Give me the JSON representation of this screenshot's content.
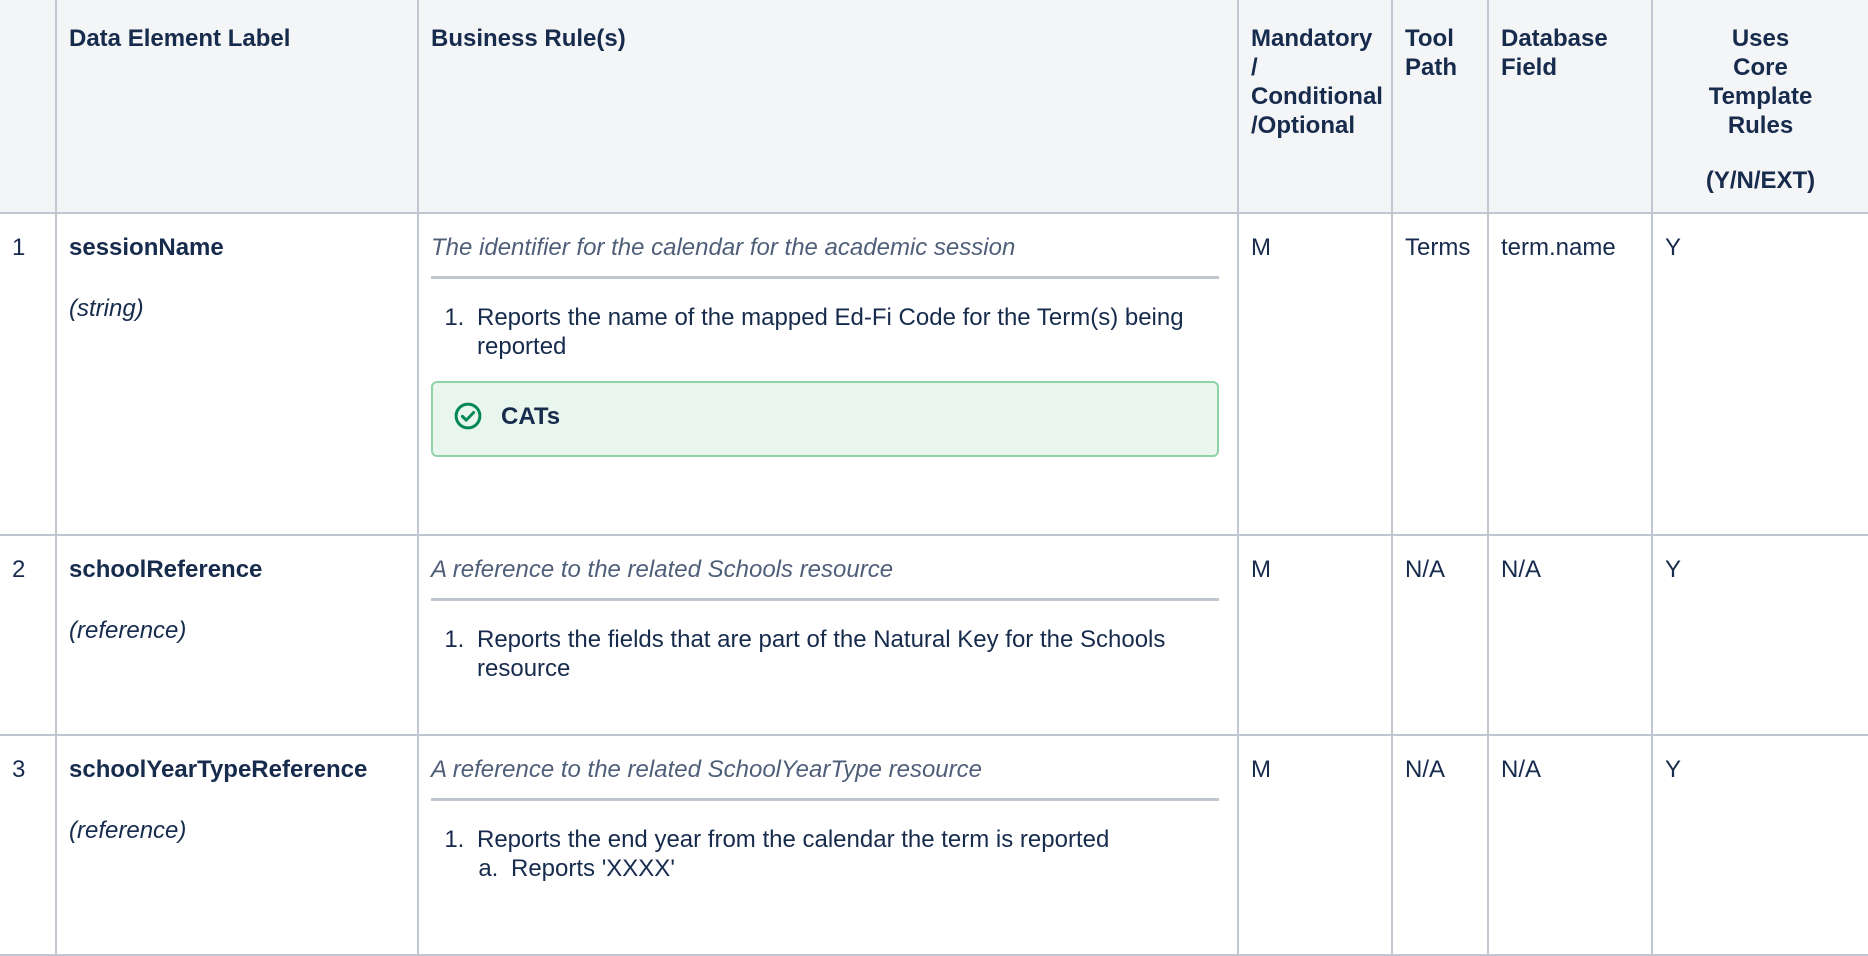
{
  "header": {
    "num": "",
    "label": "Data Element Label",
    "rules": "Business Rule(s)",
    "mandatory": [
      "Mandatory /",
      "Conditional",
      "/Optional"
    ],
    "tool_path": [
      "Tool",
      "Path"
    ],
    "db_field": [
      "Database",
      "Field"
    ],
    "core": [
      "Uses",
      "Core",
      "Template",
      "Rules"
    ],
    "core_sub": "(Y/N/EXT)"
  },
  "rows": [
    {
      "num": "1",
      "name": "sessionName",
      "type": "(string)",
      "description": "The identifier for the calendar for the academic session",
      "rule1": "Reports the name of the mapped Ed-Fi Code for the Term(s) being reported",
      "panel_title": "CATs",
      "mandatory": "M",
      "tool_path": "Terms",
      "db_field": "term.name",
      "core": "Y"
    },
    {
      "num": "2",
      "name": "schoolReference",
      "type": "(reference)",
      "description": "A reference to the related Schools resource",
      "rule1": " Reports the fields that are part of the Natural Key for the Schools resource",
      "mandatory": "M",
      "tool_path": "N/A",
      "db_field": "N/A",
      "core": "Y"
    },
    {
      "num": "3",
      "name": "schoolYearTypeReference",
      "type": "(reference)",
      "description": "A reference to the related SchoolYearType resource",
      "rule1": "Reports the end year from the calendar the term is reported",
      "rule1a": "Reports 'XXXX'",
      "mandatory": "M",
      "tool_path": "N/A",
      "db_field": "N/A",
      "core": "Y"
    }
  ],
  "colors": {
    "header_bg": "#f4f5f7",
    "border": "#c1c7d0",
    "panel_bg": "#e9f6ee",
    "panel_border": "#8fd4a8",
    "success_icon": "#00875a"
  }
}
